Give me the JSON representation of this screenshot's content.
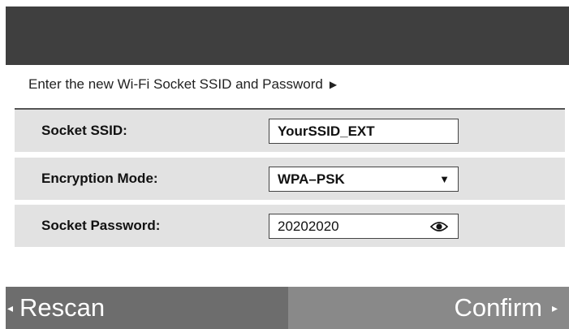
{
  "instruction": {
    "text": "Enter the new Wi-Fi Socket SSID and Password",
    "arrow": "▶"
  },
  "form": {
    "ssid": {
      "label": "Socket SSID:",
      "value": "YourSSID_EXT"
    },
    "encryption": {
      "label": "Encryption Mode:",
      "value": "WPA–PSK",
      "dropdown_arrow": "▼"
    },
    "password": {
      "label": "Socket Password:",
      "value": "20202020",
      "toggle_icon": "eye-icon"
    }
  },
  "footer": {
    "left_arrow": "◂",
    "rescan_label": "Rescan",
    "confirm_label": "Confirm",
    "right_arrow": "▸"
  },
  "colors": {
    "header": "#3f3f3f",
    "row_bg": "#e2e2e2",
    "rescan_bg": "#6d6d6d",
    "confirm_bg": "#898989"
  }
}
